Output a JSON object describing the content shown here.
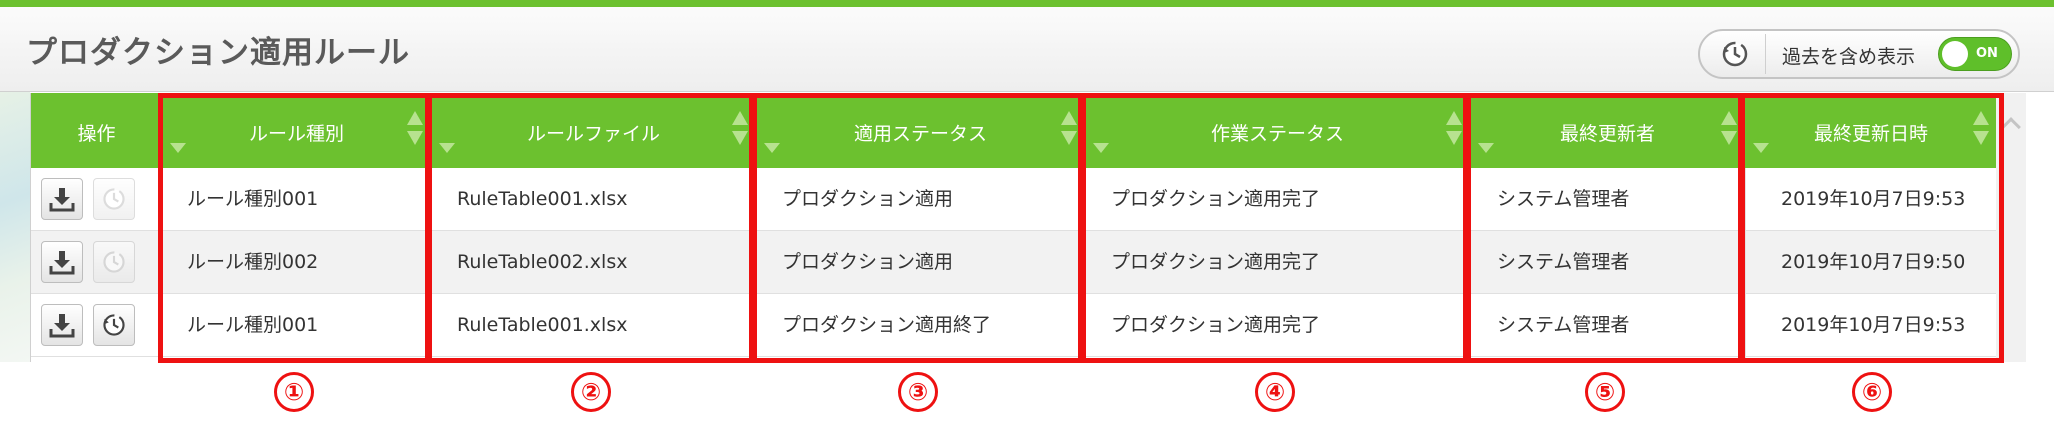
{
  "page": {
    "title": "プロダクション適用ルール",
    "history_toggle": {
      "label": "過去を含め表示",
      "switch_text": "ON",
      "switch_on": true
    }
  },
  "colors": {
    "accent": "#6cc12f",
    "annotation": "#ee1111"
  },
  "table": {
    "columns": {
      "operation": "操作",
      "rule_type": "ルール種別",
      "rule_file": "ルールファイル",
      "apply_status": "適用ステータス",
      "work_status": "作業ステータス",
      "updated_by": "最終更新者",
      "updated_at": "最終更新日時"
    },
    "rows": [
      {
        "rule_type": "ルール種別001",
        "rule_file": "RuleTable001.xlsx",
        "apply_status": "プロダクション適用",
        "work_status": "プロダクション適用完了",
        "updated_by": "システム管理者",
        "updated_at": "2019年10月7日9:53",
        "history_enabled": false
      },
      {
        "rule_type": "ルール種別002",
        "rule_file": "RuleTable002.xlsx",
        "apply_status": "プロダクション適用",
        "work_status": "プロダクション適用完了",
        "updated_by": "システム管理者",
        "updated_at": "2019年10月7日9:50",
        "history_enabled": false
      },
      {
        "rule_type": "ルール種別001",
        "rule_file": "RuleTable001.xlsx",
        "apply_status": "プロダクション適用終了",
        "work_status": "プロダクション適用完了",
        "updated_by": "システム管理者",
        "updated_at": "2019年10月7日9:53",
        "history_enabled": true
      }
    ],
    "row_icons": {
      "download": "download-icon",
      "history": "history-clock-icon"
    }
  },
  "annotations": [
    "①",
    "②",
    "③",
    "④",
    "⑤",
    "⑥"
  ]
}
